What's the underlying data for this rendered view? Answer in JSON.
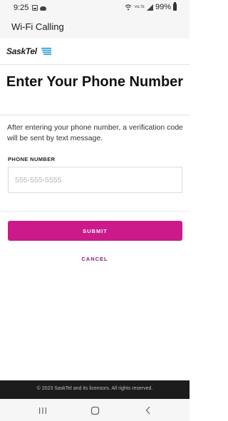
{
  "status_bar": {
    "time": "9:25",
    "network_label": "VoLTE",
    "battery_percent": "99%",
    "battery_level": 0.99
  },
  "app_bar": {
    "title": "Wi-Fi Calling"
  },
  "brand": {
    "logo_text": "SaskTel",
    "logo_color": "#1c9ad6"
  },
  "page": {
    "heading": "Enter Your Phone Number",
    "description": "After entering your phone number, a verification code will be sent by text message.",
    "phone_label": "PHONE NUMBER",
    "phone_placeholder": "555-555-5555",
    "phone_value": "",
    "submit_label": "SUBMIT",
    "cancel_label": "CANCEL"
  },
  "footer": {
    "text": "© 2023 SaskTel and its licensors. All rights reserved."
  },
  "colors": {
    "accent": "#cc1a8a",
    "cancel": "#8a1f75",
    "footer_bg": "#1c1c1c"
  },
  "nav": {
    "icons": [
      "recent-apps-icon",
      "home-icon",
      "back-icon"
    ]
  }
}
